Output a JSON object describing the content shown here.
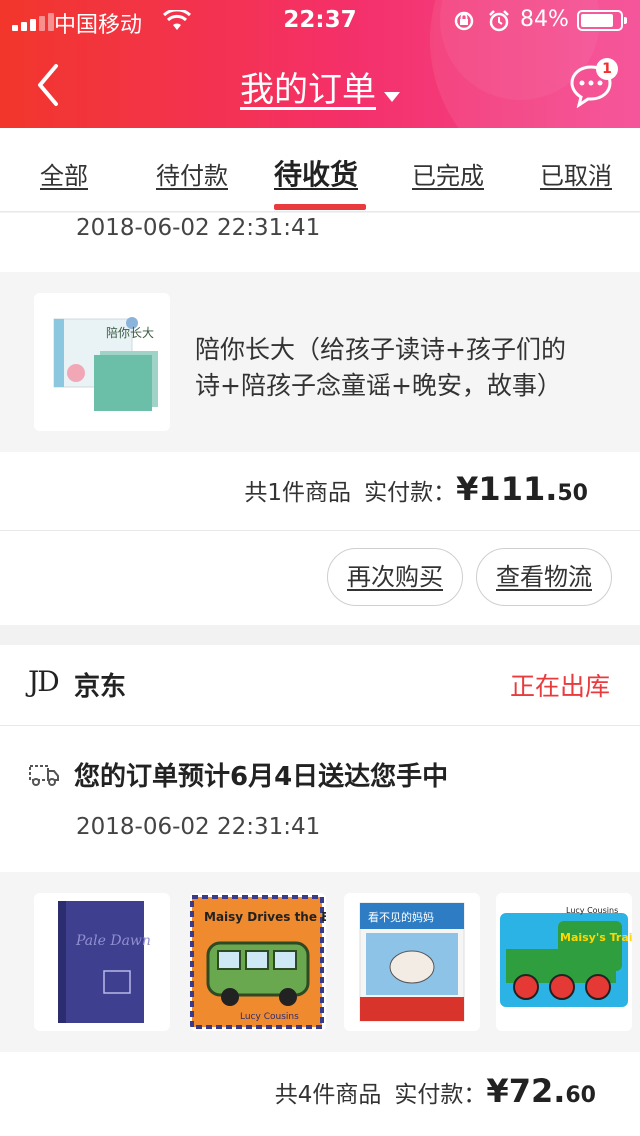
{
  "status_bar": {
    "carrier": "中国移动",
    "time": "22:37",
    "battery": "84%"
  },
  "header": {
    "title": "我的订单",
    "badge_count": "1"
  },
  "tabs": [
    {
      "label": "全部"
    },
    {
      "label": "待付款"
    },
    {
      "label": "待收货"
    },
    {
      "label": "已完成"
    },
    {
      "label": "已取消"
    }
  ],
  "order1": {
    "timestamp": "2018-06-02 22:31:41",
    "item_title_line1": "陪你长大（给孩子读诗+孩子们的",
    "item_title_line2": "诗+陪孩子念童谣+晚安，故事）",
    "cover_text": "陪你长大",
    "summary_count": "共1件商品",
    "paid_label": "实付款：",
    "price_main": "¥111.",
    "price_decimal": "50",
    "buttons": {
      "rebuy": "再次购买",
      "logistics": "查看物流"
    }
  },
  "order2": {
    "store_logo": "JD",
    "store": "京东",
    "status": "正在出库",
    "delivery_note": "您的订单预计6月4日送达您手中",
    "timestamp": "2018-06-02 22:31:41",
    "books": [
      {
        "cover_text": "Pale Dawn"
      },
      {
        "cover_text": "Maisy Drives the Bus",
        "author": "Lucy Cousins"
      },
      {
        "cover_text": "看不见的妈妈"
      },
      {
        "cover_text": "Maisy's Train",
        "author": "Lucy Cousins"
      }
    ],
    "summary_count": "共4件商品",
    "paid_label": "实付款：",
    "price_main": "¥72.",
    "price_decimal": "60"
  },
  "colors": {
    "accent": "#e93b3d",
    "header_start": "#f2362b",
    "header_end": "#f54a94"
  }
}
